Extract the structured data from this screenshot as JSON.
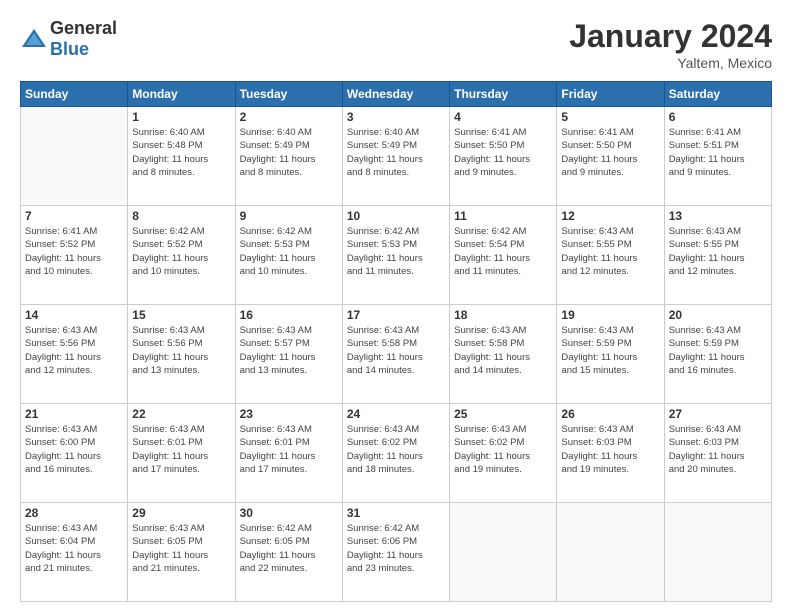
{
  "logo": {
    "general": "General",
    "blue": "Blue"
  },
  "title": {
    "month_year": "January 2024",
    "location": "Yaltem, Mexico"
  },
  "headers": [
    "Sunday",
    "Monday",
    "Tuesday",
    "Wednesday",
    "Thursday",
    "Friday",
    "Saturday"
  ],
  "weeks": [
    [
      {
        "num": "",
        "info": ""
      },
      {
        "num": "1",
        "info": "Sunrise: 6:40 AM\nSunset: 5:48 PM\nDaylight: 11 hours\nand 8 minutes."
      },
      {
        "num": "2",
        "info": "Sunrise: 6:40 AM\nSunset: 5:49 PM\nDaylight: 11 hours\nand 8 minutes."
      },
      {
        "num": "3",
        "info": "Sunrise: 6:40 AM\nSunset: 5:49 PM\nDaylight: 11 hours\nand 8 minutes."
      },
      {
        "num": "4",
        "info": "Sunrise: 6:41 AM\nSunset: 5:50 PM\nDaylight: 11 hours\nand 9 minutes."
      },
      {
        "num": "5",
        "info": "Sunrise: 6:41 AM\nSunset: 5:50 PM\nDaylight: 11 hours\nand 9 minutes."
      },
      {
        "num": "6",
        "info": "Sunrise: 6:41 AM\nSunset: 5:51 PM\nDaylight: 11 hours\nand 9 minutes."
      }
    ],
    [
      {
        "num": "7",
        "info": "Sunrise: 6:41 AM\nSunset: 5:52 PM\nDaylight: 11 hours\nand 10 minutes."
      },
      {
        "num": "8",
        "info": "Sunrise: 6:42 AM\nSunset: 5:52 PM\nDaylight: 11 hours\nand 10 minutes."
      },
      {
        "num": "9",
        "info": "Sunrise: 6:42 AM\nSunset: 5:53 PM\nDaylight: 11 hours\nand 10 minutes."
      },
      {
        "num": "10",
        "info": "Sunrise: 6:42 AM\nSunset: 5:53 PM\nDaylight: 11 hours\nand 11 minutes."
      },
      {
        "num": "11",
        "info": "Sunrise: 6:42 AM\nSunset: 5:54 PM\nDaylight: 11 hours\nand 11 minutes."
      },
      {
        "num": "12",
        "info": "Sunrise: 6:43 AM\nSunset: 5:55 PM\nDaylight: 11 hours\nand 12 minutes."
      },
      {
        "num": "13",
        "info": "Sunrise: 6:43 AM\nSunset: 5:55 PM\nDaylight: 11 hours\nand 12 minutes."
      }
    ],
    [
      {
        "num": "14",
        "info": "Sunrise: 6:43 AM\nSunset: 5:56 PM\nDaylight: 11 hours\nand 12 minutes."
      },
      {
        "num": "15",
        "info": "Sunrise: 6:43 AM\nSunset: 5:56 PM\nDaylight: 11 hours\nand 13 minutes."
      },
      {
        "num": "16",
        "info": "Sunrise: 6:43 AM\nSunset: 5:57 PM\nDaylight: 11 hours\nand 13 minutes."
      },
      {
        "num": "17",
        "info": "Sunrise: 6:43 AM\nSunset: 5:58 PM\nDaylight: 11 hours\nand 14 minutes."
      },
      {
        "num": "18",
        "info": "Sunrise: 6:43 AM\nSunset: 5:58 PM\nDaylight: 11 hours\nand 14 minutes."
      },
      {
        "num": "19",
        "info": "Sunrise: 6:43 AM\nSunset: 5:59 PM\nDaylight: 11 hours\nand 15 minutes."
      },
      {
        "num": "20",
        "info": "Sunrise: 6:43 AM\nSunset: 5:59 PM\nDaylight: 11 hours\nand 16 minutes."
      }
    ],
    [
      {
        "num": "21",
        "info": "Sunrise: 6:43 AM\nSunset: 6:00 PM\nDaylight: 11 hours\nand 16 minutes."
      },
      {
        "num": "22",
        "info": "Sunrise: 6:43 AM\nSunset: 6:01 PM\nDaylight: 11 hours\nand 17 minutes."
      },
      {
        "num": "23",
        "info": "Sunrise: 6:43 AM\nSunset: 6:01 PM\nDaylight: 11 hours\nand 17 minutes."
      },
      {
        "num": "24",
        "info": "Sunrise: 6:43 AM\nSunset: 6:02 PM\nDaylight: 11 hours\nand 18 minutes."
      },
      {
        "num": "25",
        "info": "Sunrise: 6:43 AM\nSunset: 6:02 PM\nDaylight: 11 hours\nand 19 minutes."
      },
      {
        "num": "26",
        "info": "Sunrise: 6:43 AM\nSunset: 6:03 PM\nDaylight: 11 hours\nand 19 minutes."
      },
      {
        "num": "27",
        "info": "Sunrise: 6:43 AM\nSunset: 6:03 PM\nDaylight: 11 hours\nand 20 minutes."
      }
    ],
    [
      {
        "num": "28",
        "info": "Sunrise: 6:43 AM\nSunset: 6:04 PM\nDaylight: 11 hours\nand 21 minutes."
      },
      {
        "num": "29",
        "info": "Sunrise: 6:43 AM\nSunset: 6:05 PM\nDaylight: 11 hours\nand 21 minutes."
      },
      {
        "num": "30",
        "info": "Sunrise: 6:42 AM\nSunset: 6:05 PM\nDaylight: 11 hours\nand 22 minutes."
      },
      {
        "num": "31",
        "info": "Sunrise: 6:42 AM\nSunset: 6:06 PM\nDaylight: 11 hours\nand 23 minutes."
      },
      {
        "num": "",
        "info": ""
      },
      {
        "num": "",
        "info": ""
      },
      {
        "num": "",
        "info": ""
      }
    ]
  ]
}
